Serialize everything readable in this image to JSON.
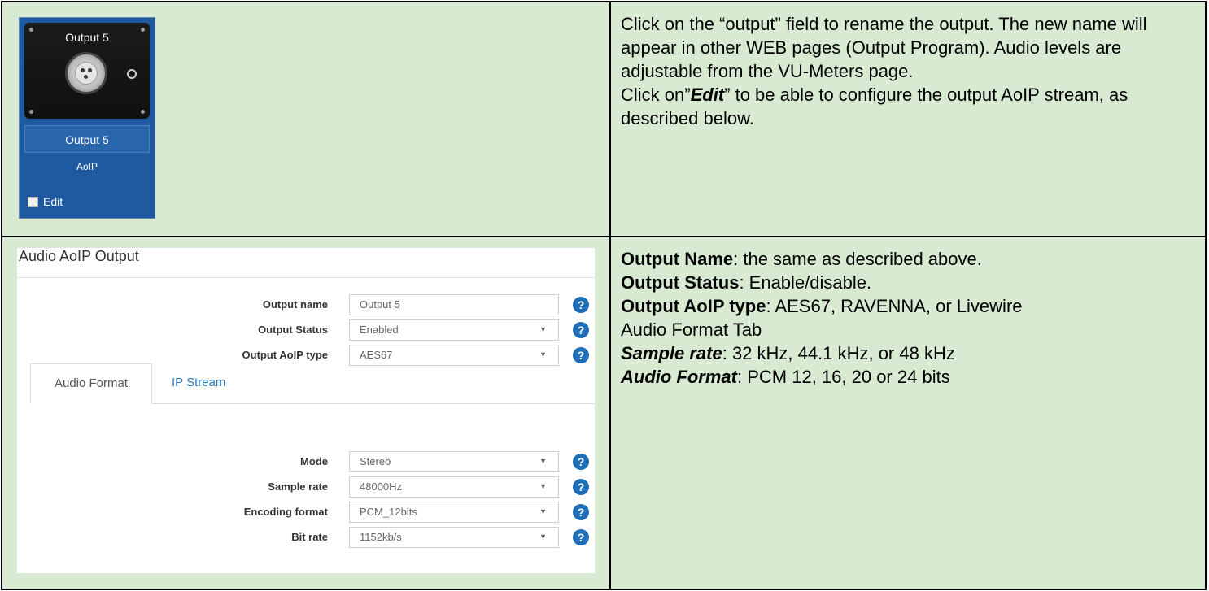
{
  "tile": {
    "title": "Output 5",
    "name": "Output 5",
    "type": "AoIP",
    "edit_label": "Edit"
  },
  "desc1": {
    "line1": "Click on the “output” field to rename the output. The new name will appear in other WEB pages (Output Program). Audio levels are adjustable from the VU-Meters page.",
    "line2_pre": "Click on”",
    "line2_em": "Edit",
    "line2_post": "” to be able to configure the output AoIP stream, as described below."
  },
  "panel": {
    "title": "Audio AoIP Output",
    "fields": [
      {
        "label": "Output name",
        "value": "Output 5"
      },
      {
        "label": "Output Status",
        "value": "Enabled"
      },
      {
        "label": "Output AoIP type",
        "value": "AES67"
      }
    ],
    "tabs": [
      "Audio Format",
      "IP Stream"
    ],
    "format_fields": [
      {
        "label": "Mode",
        "value": "Stereo"
      },
      {
        "label": "Sample rate",
        "value": "48000Hz"
      },
      {
        "label": "Encoding format",
        "value": "PCM_12bits"
      },
      {
        "label": "Bit rate",
        "value": "1152kb/s"
      }
    ],
    "help_glyph": "?",
    "select_arrow": "▼"
  },
  "desc2": {
    "name_label": "Output Name",
    "name_text": ": the same as described above.",
    "status_label": "Output Status",
    "status_text": ": Enable/disable.",
    "type_label": "Output AoIP type",
    "type_text": ": AES67, RAVENNA, or Livewire",
    "tab_heading": "Audio Format Tab",
    "rate_label": "Sample rate",
    "rate_text": ": 32 kHz, 44.1 kHz, or 48 kHz",
    "format_label": "Audio Format",
    "format_text": ": PCM 12, 16, 20 or 24 bits"
  },
  "colors": {
    "cell_bg": "#d9ead3",
    "tile_blue": "#1f5aa0",
    "link_blue": "#2a7bc0",
    "help_blue": "#1e6fb8"
  }
}
